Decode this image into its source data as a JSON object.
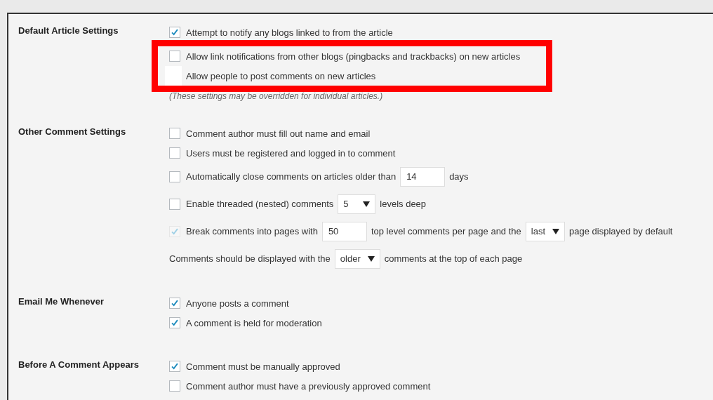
{
  "sections": [
    {
      "label": "Default Article Settings",
      "rows": [
        {
          "kind": "checkbox",
          "checked": true,
          "disabled": false,
          "highlighted": false,
          "parts": [
            {
              "kind": "text",
              "text": "Attempt to notify any blogs linked to from the article"
            }
          ]
        },
        {
          "kind": "checkbox",
          "checked": false,
          "disabled": false,
          "highlighted": true,
          "parts": [
            {
              "kind": "text",
              "text": "Allow link notifications from other blogs (pingbacks and trackbacks) on new articles"
            }
          ]
        },
        {
          "kind": "blank",
          "highlighted": true,
          "parts": [
            {
              "kind": "text",
              "text": "Allow people to post comments on new articles"
            }
          ]
        }
      ],
      "note": "(These settings may be overridden for individual articles.)"
    },
    {
      "label": "Other Comment Settings",
      "rows": [
        {
          "kind": "checkbox",
          "checked": false,
          "disabled": false,
          "highlighted": false,
          "parts": [
            {
              "kind": "text",
              "text": "Comment author must fill out name and email"
            }
          ]
        },
        {
          "kind": "checkbox",
          "checked": false,
          "disabled": false,
          "highlighted": false,
          "parts": [
            {
              "kind": "text",
              "text": "Users must be registered and logged in to comment"
            }
          ]
        },
        {
          "kind": "checkbox",
          "checked": false,
          "disabled": false,
          "highlighted": false,
          "parts": [
            {
              "kind": "text",
              "text": "Automatically close comments on articles older than"
            },
            {
              "kind": "input",
              "value": "14"
            },
            {
              "kind": "text",
              "text": "days"
            }
          ]
        },
        {
          "kind": "checkbox",
          "checked": false,
          "disabled": false,
          "highlighted": false,
          "parts": [
            {
              "kind": "text",
              "text": "Enable threaded (nested) comments"
            },
            {
              "kind": "select",
              "value": "5"
            },
            {
              "kind": "text",
              "text": "levels deep"
            }
          ]
        },
        {
          "kind": "checkbox",
          "checked": true,
          "disabled": true,
          "highlighted": false,
          "parts": [
            {
              "kind": "text",
              "text": "Break comments into pages with"
            },
            {
              "kind": "input",
              "value": "50"
            },
            {
              "kind": "text",
              "text": "top level comments per page and the"
            },
            {
              "kind": "select",
              "value": "last"
            },
            {
              "kind": "text",
              "text": "page displayed by default"
            }
          ]
        },
        {
          "kind": "plain",
          "highlighted": false,
          "parts": [
            {
              "kind": "text",
              "text": "Comments should be displayed with the"
            },
            {
              "kind": "select",
              "value": "older"
            },
            {
              "kind": "text",
              "text": "comments at the top of each page"
            }
          ]
        }
      ]
    },
    {
      "label": "Email Me Whenever",
      "rows": [
        {
          "kind": "checkbox",
          "checked": true,
          "disabled": false,
          "highlighted": false,
          "parts": [
            {
              "kind": "text",
              "text": "Anyone posts a comment"
            }
          ]
        },
        {
          "kind": "checkbox",
          "checked": true,
          "disabled": false,
          "highlighted": false,
          "parts": [
            {
              "kind": "text",
              "text": "A comment is held for moderation"
            }
          ]
        }
      ]
    },
    {
      "label": "Before A Comment Appears",
      "rows": [
        {
          "kind": "checkbox",
          "checked": true,
          "disabled": false,
          "highlighted": false,
          "parts": [
            {
              "kind": "text",
              "text": "Comment must be manually approved"
            }
          ]
        },
        {
          "kind": "checkbox",
          "checked": false,
          "disabled": false,
          "highlighted": false,
          "parts": [
            {
              "kind": "text",
              "text": "Comment author must have a previously approved comment"
            }
          ]
        }
      ]
    }
  ]
}
